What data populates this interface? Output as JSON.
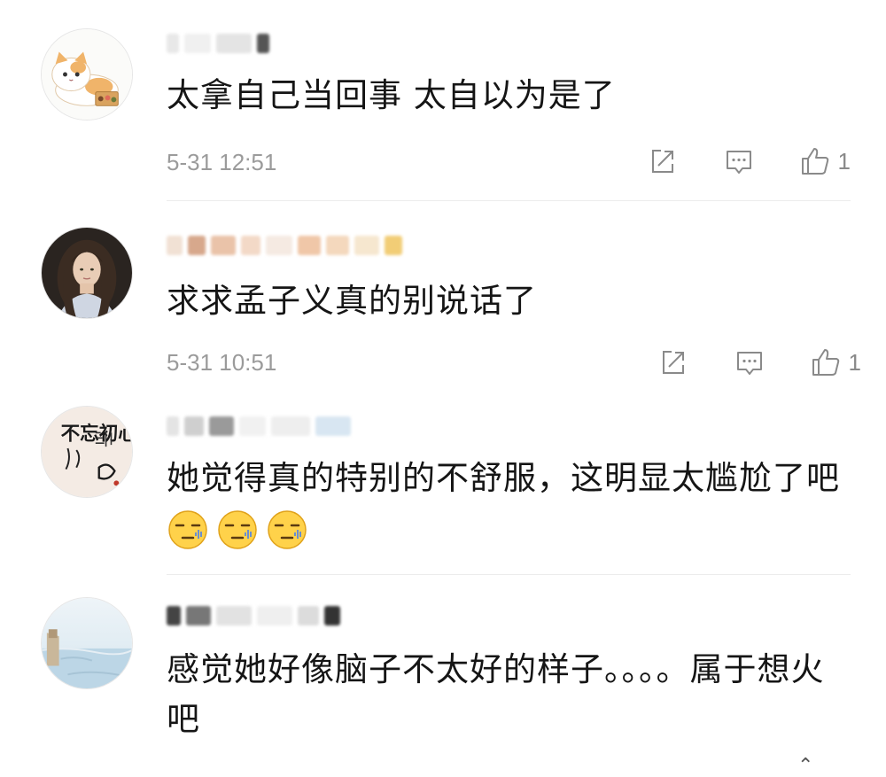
{
  "comments": [
    {
      "content": "太拿自己当回事 太自以为是了",
      "time": "5-31 12:51",
      "likes": "1",
      "avatar": "cat-avatar"
    },
    {
      "content": "求求孟子义真的别说话了",
      "time": "5-31 10:51",
      "likes": "1",
      "avatar": "girl-photo-avatar"
    },
    {
      "content": "她觉得真的特别的不舒服，这明显太尴尬了吧",
      "avatar": "calligraphy-avatar",
      "avatar_text": "不忘初心",
      "emojis": [
        "awkward-face-icon",
        "awkward-face-icon",
        "awkward-face-icon"
      ]
    },
    {
      "content": "感觉她好像脑子不太好的样子。。。。属于想火吧",
      "avatar": "seaside-painting-avatar"
    }
  ],
  "icons": {
    "share": "share-icon",
    "reply": "comment-icon",
    "like": "thumbs-up-icon"
  },
  "colors": {
    "meta_text": "#9b9b9b",
    "icon_stroke": "#8a8a8a",
    "divider": "#ececec"
  }
}
